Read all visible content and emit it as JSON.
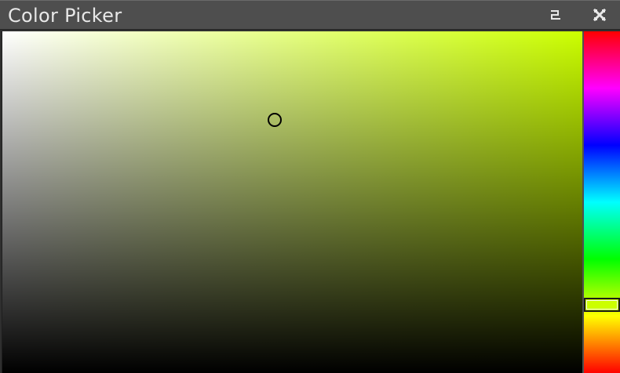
{
  "window": {
    "title": "Color Picker"
  },
  "titlebar": {
    "menu_icon": "menu-icon",
    "close_icon": "close-icon"
  },
  "picker": {
    "hue_degrees": 72,
    "hue_color": "#ccff00",
    "saturation": 0.47,
    "value": 0.74,
    "selected_color": "#bfef00"
  },
  "colors": {
    "titlebar_bg": "#4e4e4e",
    "title_text": "#e8e8e8",
    "cursor_ring": "#000000"
  }
}
